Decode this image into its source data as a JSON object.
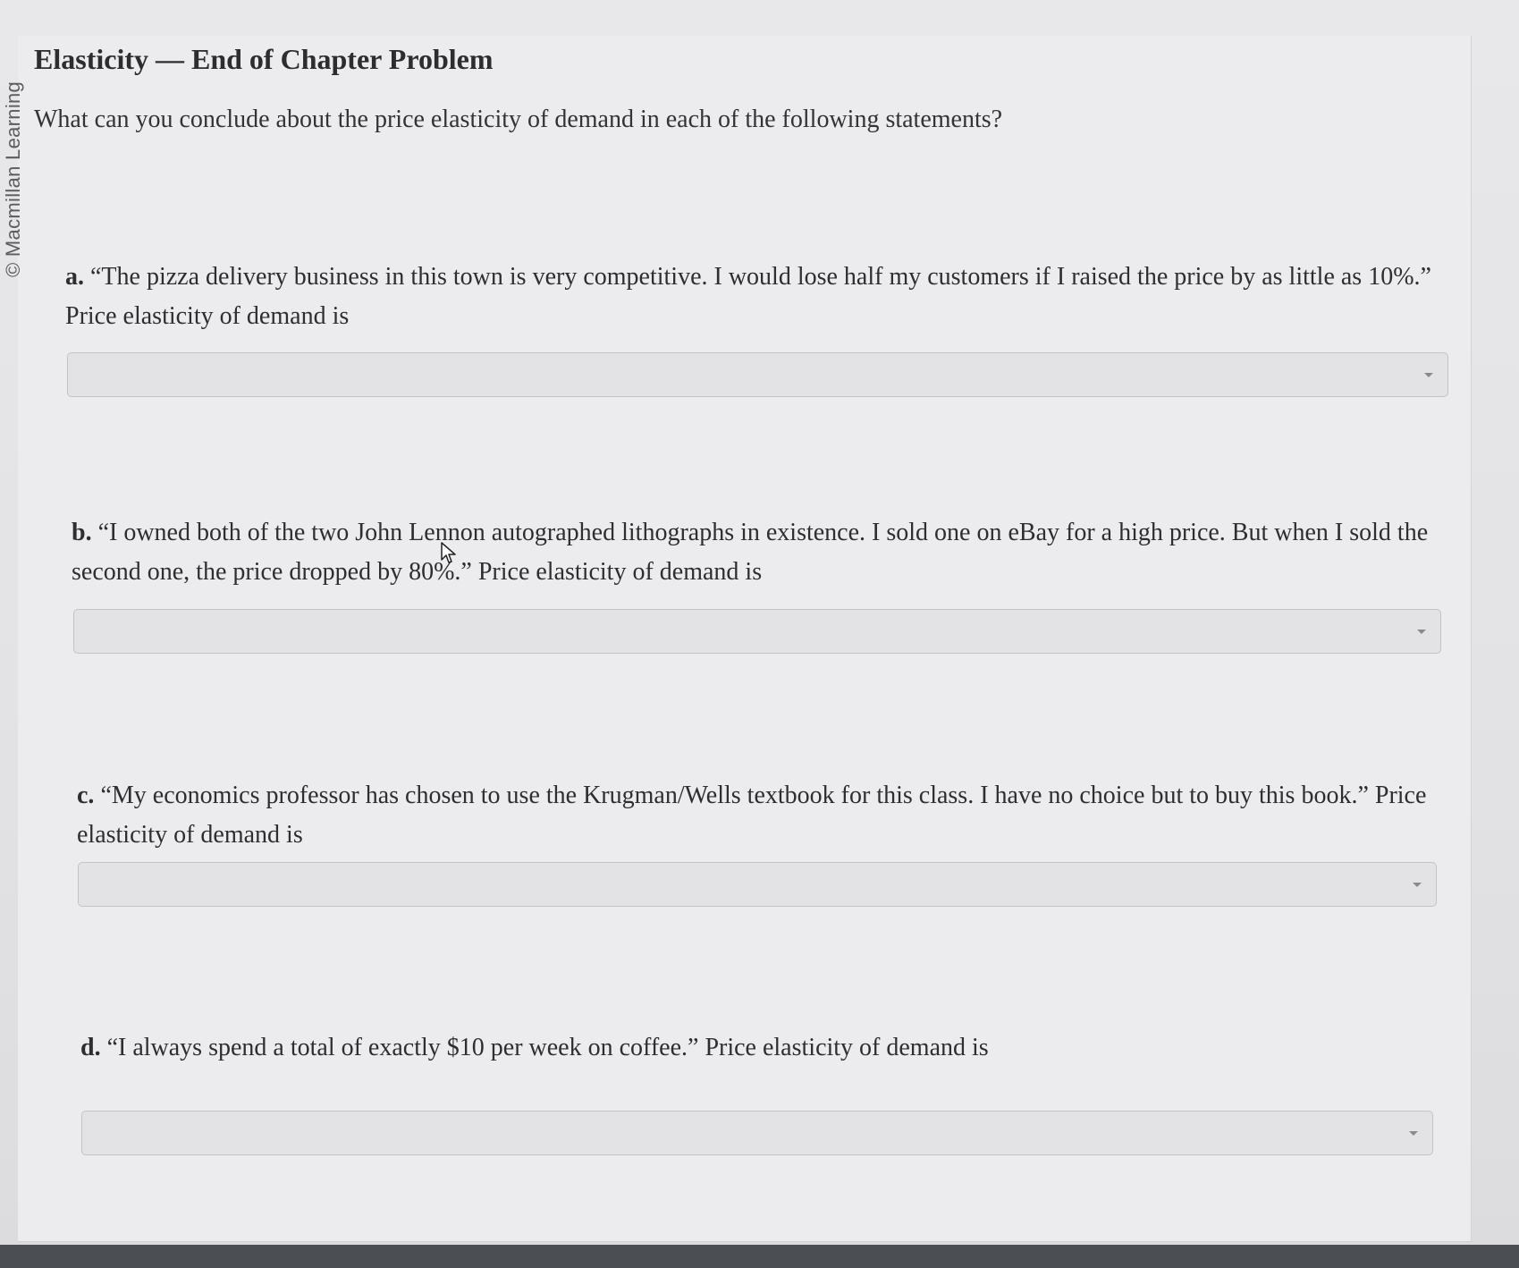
{
  "watermark": {
    "copyright": "© Macmillan Learning"
  },
  "header": {
    "title": "Elasticity — End of Chapter Problem",
    "prompt": "What can you conclude about the price elasticity of demand in each of the following statements?"
  },
  "questions": [
    {
      "letter": "a.",
      "text": "“The pizza delivery business in this town is very competitive. I would lose half my customers if I raised the price by as little as 10%.” Price elasticity of demand is",
      "selected": ""
    },
    {
      "letter": "b.",
      "text": "“I owned both of the two John Lennon autographed lithographs in existence. I sold one on eBay for a high price. But when I sold the second one, the price dropped by 80%.” Price elasticity of demand is",
      "selected": ""
    },
    {
      "letter": "c.",
      "text": "“My economics professor has chosen to use the Krugman/Wells textbook for this class. I have no choice but to buy this book.” Price elasticity of demand is",
      "selected": ""
    },
    {
      "letter": "d.",
      "text": "“I always spend a total of exactly $10 per week on coffee.” Price elasticity of demand is",
      "selected": ""
    }
  ],
  "icons": {
    "dropdown": "chevron-down-icon",
    "cursor": "mouse-pointer-icon"
  },
  "colors": {
    "page_background": "#e8e8ea",
    "dropdown_fill": "#e3e3e5",
    "dropdown_border": "#c3c3c6",
    "text": "#2e2e31",
    "bottom_bar": "#4b4e52"
  }
}
